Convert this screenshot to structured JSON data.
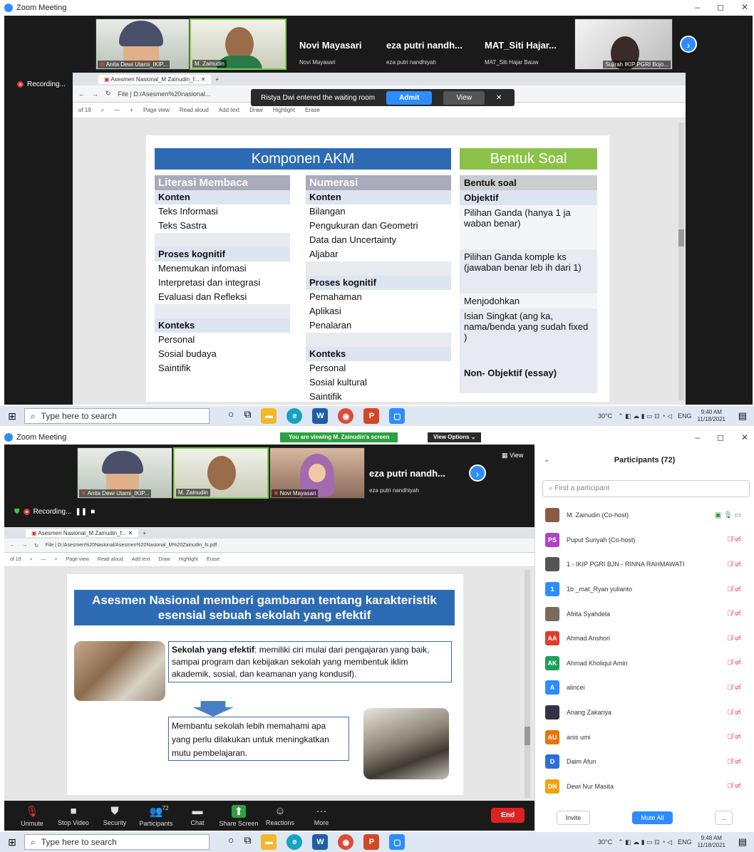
{
  "top": {
    "window_title": "Zoom Meeting",
    "tiles": [
      {
        "name": "Anita Dewi Utami_IKIP..."
      },
      {
        "name": "M. Zainudin"
      }
    ],
    "name_tiles": [
      {
        "title": "Novi Mayasari",
        "sub": "Novi Mayasari"
      },
      {
        "title": "eza putri nandh...",
        "sub": "eza putri nandhiyah"
      },
      {
        "title": "MAT_Siti Hajar...",
        "sub": "MAT_Siti Hajar Bauw"
      }
    ],
    "last_tile": {
      "name": "Sujirah IKIP PGRI Bojo..."
    },
    "recording": "Recording...",
    "browser": {
      "tab": "Asesmen Nasional_M Zainudin_f...",
      "address": "File  |  D:/Asesmen%20nasional...",
      "page_count": "of 19",
      "tools": [
        "Page view",
        "Read aloud",
        "Add text",
        "Draw",
        "Highlight",
        "Erase"
      ]
    },
    "waiting_room": {
      "message": "Ristya Dwi entered the waiting room",
      "admit": "Admit",
      "view": "View"
    },
    "slide": {
      "title": "Komponen AKM",
      "bentuk_title": "Bentuk Soal",
      "literasi": {
        "header": "Literasi Membaca",
        "rows": [
          {
            "t": "Konten",
            "s": "b"
          },
          {
            "t": "Teks Informasi",
            "s": ""
          },
          {
            "t": "Teks Sastra",
            "s": ""
          },
          {
            "t": "",
            "s": "g"
          },
          {
            "t": "Proses kognitif",
            "s": "b"
          },
          {
            "t": "Menemukan infomasi",
            "s": ""
          },
          {
            "t": "Interpretasi dan integrasi",
            "s": ""
          },
          {
            "t": "Evaluasi dan Refleksi",
            "s": ""
          },
          {
            "t": "",
            "s": "g"
          },
          {
            "t": "Konteks",
            "s": "b"
          },
          {
            "t": "Personal",
            "s": ""
          },
          {
            "t": "Sosial budaya",
            "s": ""
          },
          {
            "t": "Saintifik",
            "s": ""
          }
        ]
      },
      "numerasi": {
        "header": "Numerasi",
        "rows": [
          {
            "t": "Konten",
            "s": "b"
          },
          {
            "t": "Bilangan",
            "s": ""
          },
          {
            "t": "Pengukuran dan Geometri",
            "s": ""
          },
          {
            "t": "Data dan Uncertainty",
            "s": ""
          },
          {
            "t": "Aljabar",
            "s": ""
          },
          {
            "t": "",
            "s": "g"
          },
          {
            "t": "Proses kognitif",
            "s": "b"
          },
          {
            "t": "Pemahaman",
            "s": ""
          },
          {
            "t": "Aplikasi",
            "s": ""
          },
          {
            "t": "Penalaran",
            "s": ""
          },
          {
            "t": "",
            "s": "g"
          },
          {
            "t": "Konteks",
            "s": "b"
          },
          {
            "t": "Personal",
            "s": ""
          },
          {
            "t": "Sosial kultural",
            "s": ""
          },
          {
            "t": "Saintifik",
            "s": ""
          }
        ]
      },
      "bentuk": [
        "Bentuk soal",
        "Objektif",
        "Pilihan Ganda (hanya 1 ja waban benar)",
        "Pilihan Ganda komple ks (jawaban benar leb ih dari 1)",
        "Menjodohkan",
        "Isian Singkat (ang ka, nama/benda yang sudah fixed )",
        "Non- Objektif (essay)"
      ]
    },
    "taskbar": {
      "search": "Type here to search",
      "temp": "30°C",
      "lang": "ENG",
      "time": "9:40 AM",
      "date": "11/18/2021"
    }
  },
  "bottom": {
    "window_title": "Zoom Meeting",
    "viewing": "You are viewing M. Zainudin's screen",
    "view_options": "View Options ⌄",
    "view_label": "View",
    "tiles": [
      {
        "name": "Anita Dewi Utami_IKIP..."
      },
      {
        "name": "M. Zainudin"
      },
      {
        "name": "Novi Mayasari"
      }
    ],
    "name_tile": {
      "title": "eza putri nandh...",
      "sub": "eza putri nandhiyah"
    },
    "recording": "Recording...",
    "browser": {
      "tab": "Asesmen Nasional_M Zainudin_f...",
      "address": "File  |  D:/Asesmen%20Nasional/Asesmen%20Nasional_M%20Zainudin_fs.pdf",
      "page_count": "of 19",
      "tools": [
        "Page view",
        "Read aloud",
        "Add text",
        "Draw",
        "Highlight",
        "Erase"
      ]
    },
    "slide": {
      "title": "Asesmen Nasional memberi gambaran tentang karakteristik esensial sebuah sekolah yang efektif",
      "box1_bold": "Sekolah yang efektif",
      "box1_text": ": memiliki ciri mulai dari pengajaran yang baik, sampai program dan kebijakan sekolah yang membentuk iklim akademik, sosial, dan keamanan yang kondusif).",
      "box2_text": "Membantu sekolah lebih memahami apa yang perlu dilakukan untuk meningkatkan mutu pembelajaran."
    },
    "participants": {
      "title": "Participants (72)",
      "search_placeholder": "Find a participant",
      "items": [
        {
          "initials": "",
          "name": "M. Zainudin (Co-host)",
          "color": "#8a5a44"
        },
        {
          "initials": "PS",
          "name": "Puput Suriyah (Co-host)",
          "color": "#b042c9"
        },
        {
          "initials": "",
          "name": "1 - IKIP PGRI BJN - RINNA RAHMAWATI",
          "color": "#555555"
        },
        {
          "initials": "1",
          "name": "1b _mat_Ryan yulianto",
          "color": "#2d8cff"
        },
        {
          "initials": "",
          "name": "Afrita Syahdela",
          "color": "#7a6a5a"
        },
        {
          "initials": "AA",
          "name": "Ahmad Anshori",
          "color": "#e03c2c"
        },
        {
          "initials": "AK",
          "name": "Ahmad Kholiqul Amin",
          "color": "#1f9e5a"
        },
        {
          "initials": "A",
          "name": "alincei",
          "color": "#2d8cff"
        },
        {
          "initials": "",
          "name": "Anang Zakariya",
          "color": "#333344"
        },
        {
          "initials": "AU",
          "name": "anis umi",
          "color": "#e8740c"
        },
        {
          "initials": "D",
          "name": "Daim Afun",
          "color": "#2d6fd6"
        },
        {
          "initials": "DN",
          "name": "Dewi Nur Masita",
          "color": "#f5a00a"
        }
      ],
      "invite": "Invite",
      "mute_all": "Mute All",
      "more": "..."
    },
    "toolbar": [
      {
        "icon": "microphone-muted-icon",
        "label": "Unmute"
      },
      {
        "icon": "video-icon",
        "label": "Stop Video"
      },
      {
        "icon": "shield-icon",
        "label": "Security"
      },
      {
        "icon": "participants-icon",
        "label": "Participants",
        "badge": "72"
      },
      {
        "icon": "chat-icon",
        "label": "Chat"
      },
      {
        "icon": "share-screen-icon",
        "label": "Share Screen"
      },
      {
        "icon": "reactions-icon",
        "label": "Reactions"
      },
      {
        "icon": "more-icon",
        "label": "More"
      }
    ],
    "end": "End",
    "taskbar": {
      "search": "Type here to search",
      "temp": "30°C",
      "lang": "ENG",
      "time": "9:48 AM",
      "date": "11/18/2021"
    }
  }
}
